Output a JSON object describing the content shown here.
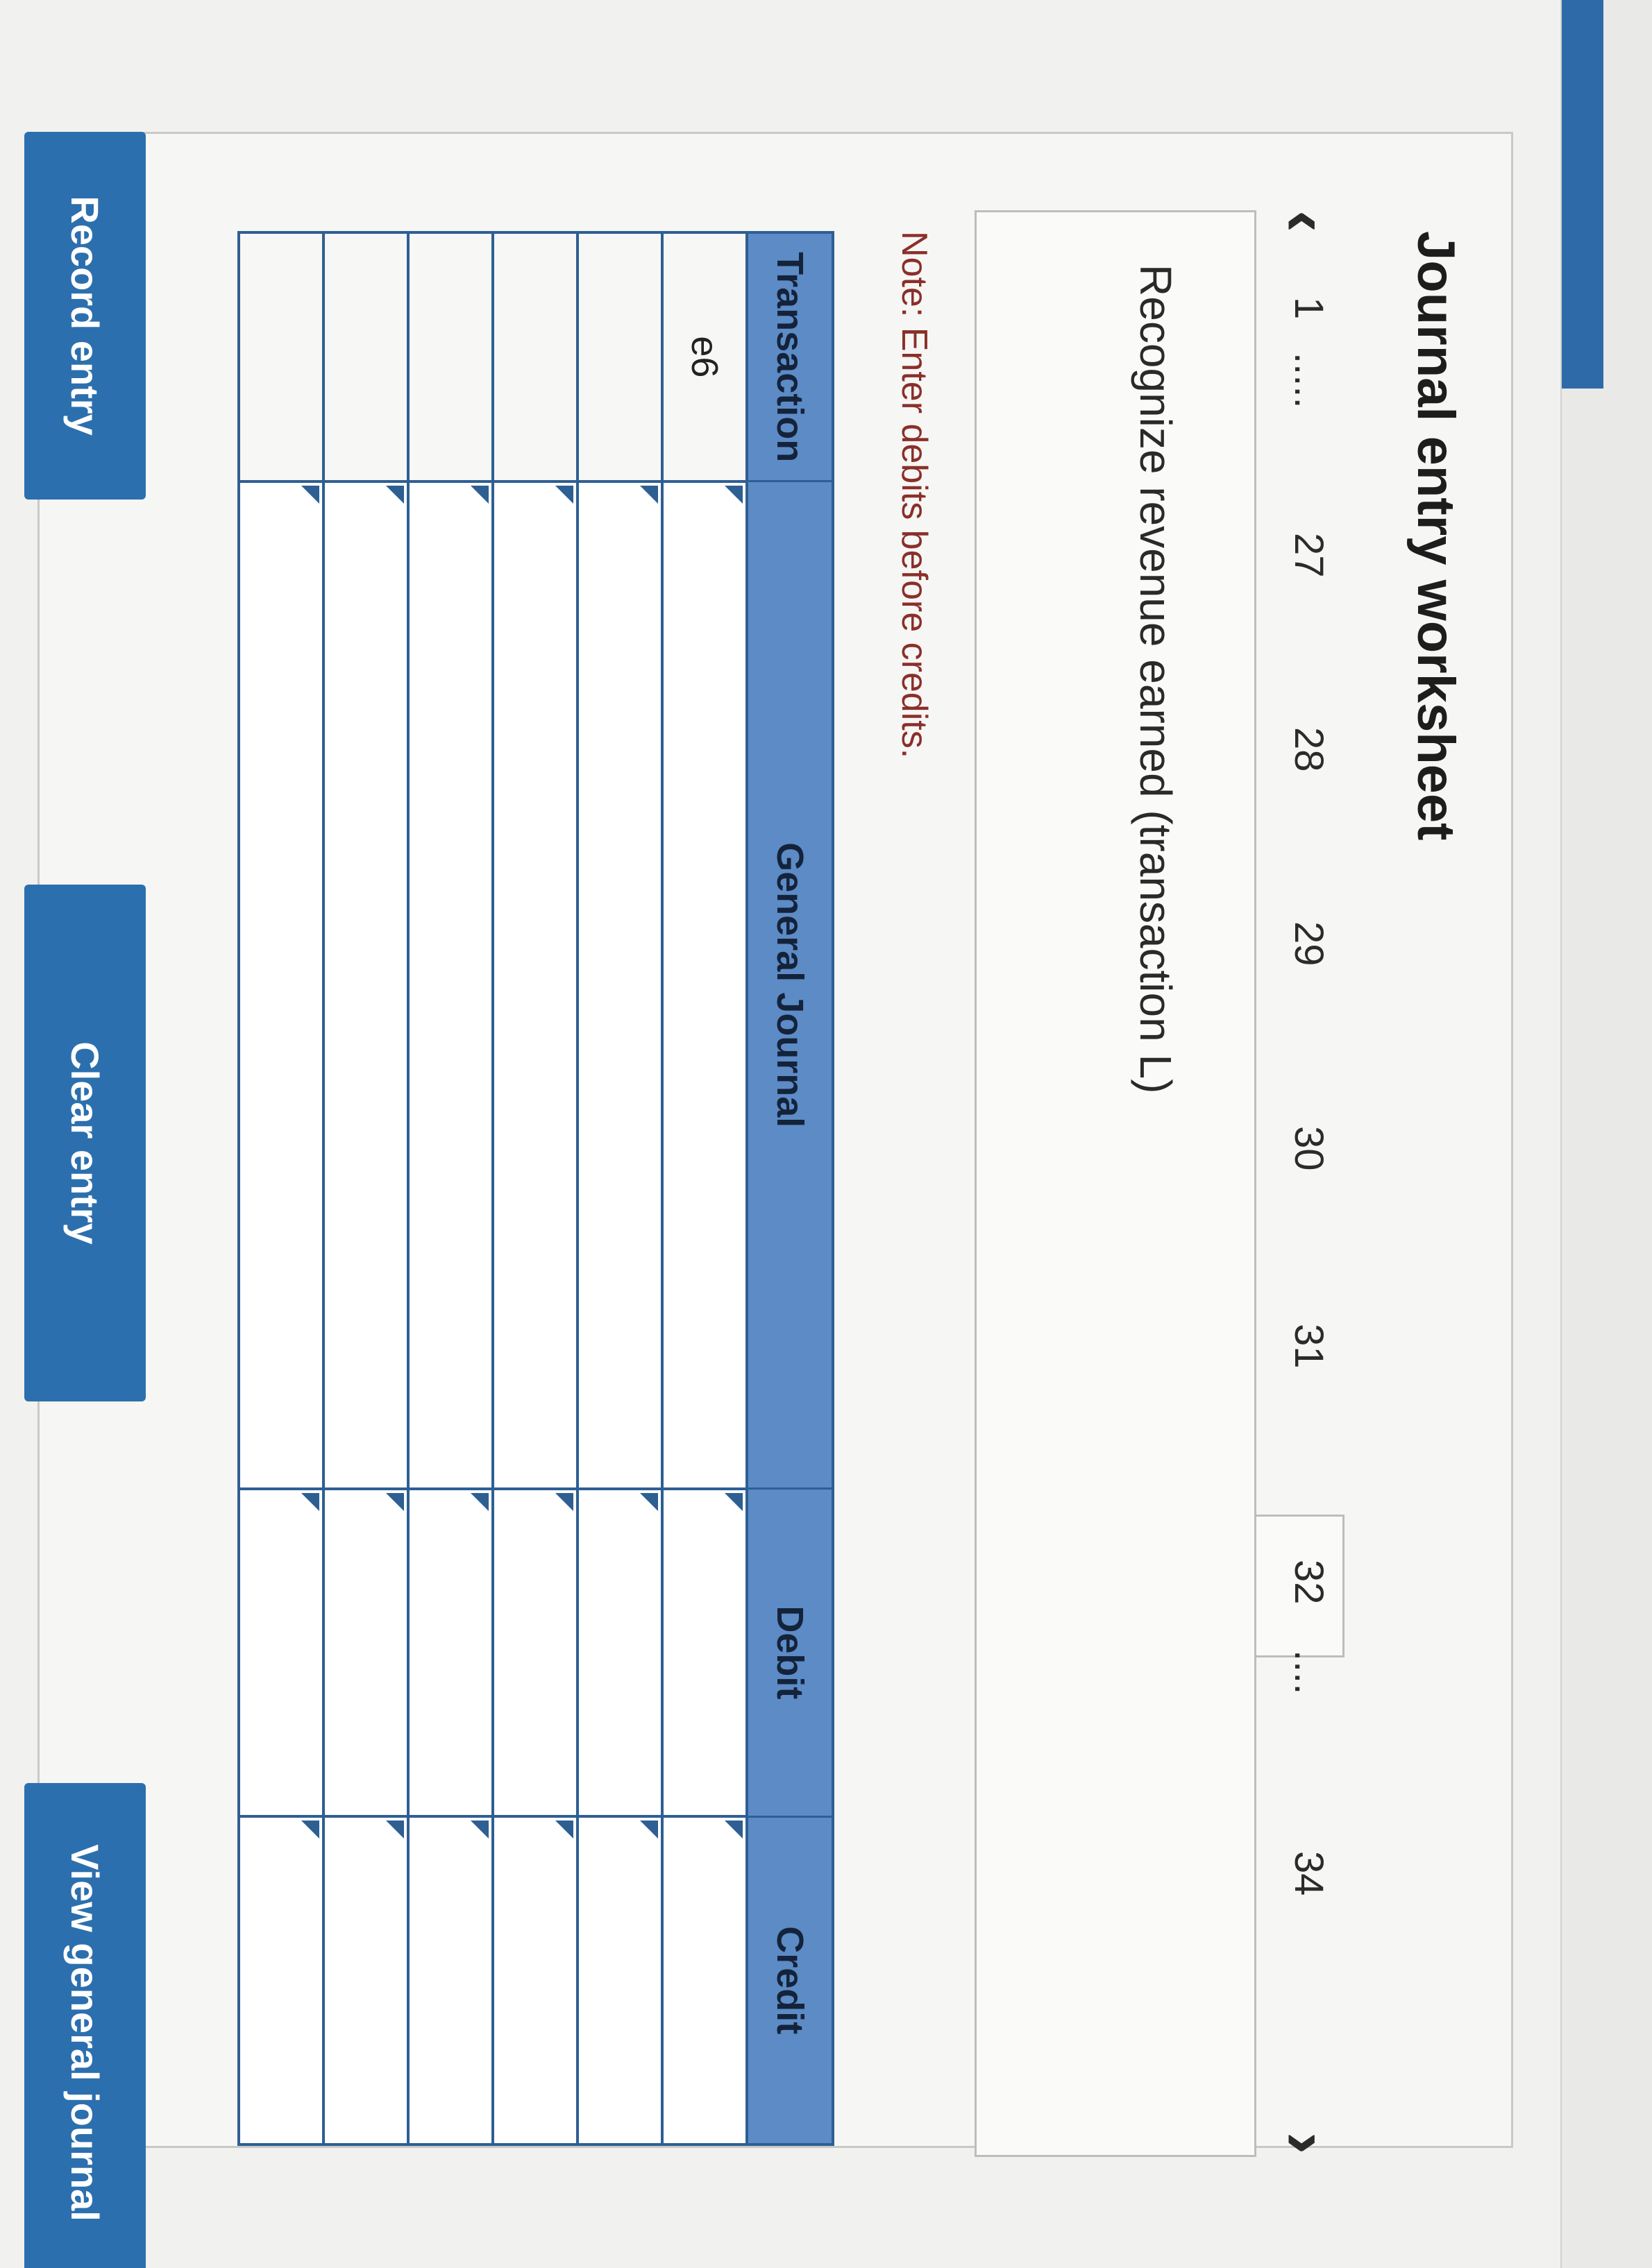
{
  "worksheet": {
    "title": "Journal entry worksheet"
  },
  "pager": {
    "prev_icon": "chevron-left-icon",
    "next_icon": "chevron-right-icon",
    "items": [
      "1",
      ".....",
      "27",
      "28",
      "29",
      "30",
      "31",
      "32",
      "....",
      "34"
    ],
    "active": "32"
  },
  "prompt": {
    "text": "Recognize revenue earned (transaction L)"
  },
  "note": {
    "text": "Note: Enter debits before credits."
  },
  "journal": {
    "headers": {
      "transaction": "Transaction",
      "general_journal": "General Journal",
      "debit": "Debit",
      "credit": "Credit"
    },
    "rows": [
      {
        "transaction": "e6",
        "account": "",
        "debit": "",
        "credit": ""
      },
      {
        "transaction": "",
        "account": "",
        "debit": "",
        "credit": ""
      },
      {
        "transaction": "",
        "account": "",
        "debit": "",
        "credit": ""
      },
      {
        "transaction": "",
        "account": "",
        "debit": "",
        "credit": ""
      },
      {
        "transaction": "",
        "account": "",
        "debit": "",
        "credit": ""
      },
      {
        "transaction": "",
        "account": "",
        "debit": "",
        "credit": ""
      }
    ]
  },
  "buttons": {
    "record": "Record entry",
    "clear": "Clear entry",
    "view": "View general journal"
  },
  "colors": {
    "header_blue": "#5c8bc6",
    "grid_blue": "#2e5f93",
    "button_blue": "#2c6fae",
    "note_red": "#8a2f2a"
  }
}
